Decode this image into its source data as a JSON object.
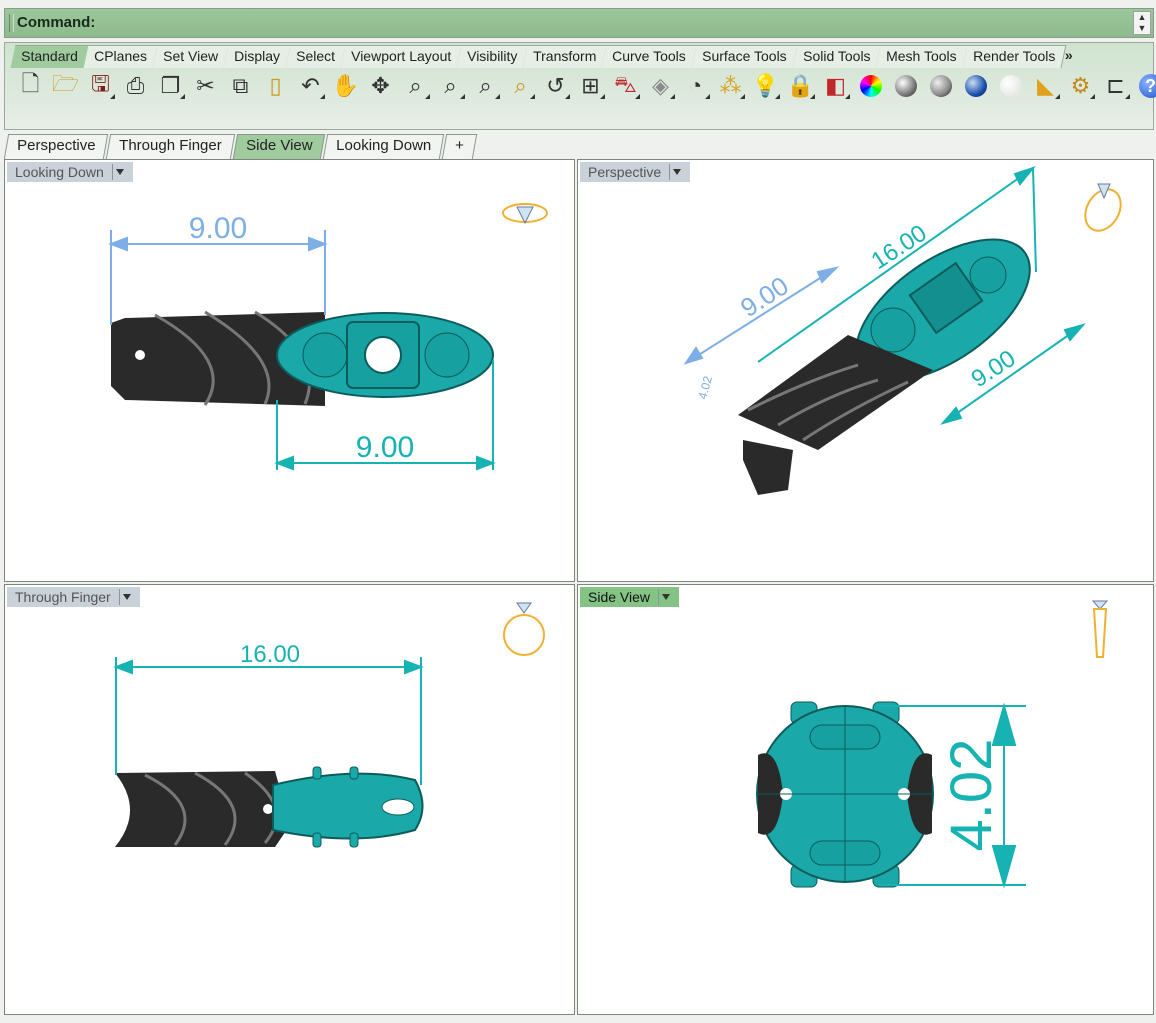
{
  "command": {
    "label": "Command:"
  },
  "toolbar_tabs": [
    "Standard",
    "CPlanes",
    "Set View",
    "Display",
    "Select",
    "Viewport Layout",
    "Visibility",
    "Transform",
    "Curve Tools",
    "Surface Tools",
    "Solid Tools",
    "Mesh Tools",
    "Render Tools"
  ],
  "toolbar_tabs_more": "»",
  "toolbar_icons": [
    "new-file",
    "open-file",
    "save",
    "print",
    "properties",
    "cut",
    "copy",
    "paste",
    "undo",
    "pan",
    "rotate-view",
    "zoom-window",
    "zoom-extents",
    "zoom-selected",
    "zoom-target",
    "undo-view",
    "four-viewports",
    "car-render",
    "grid",
    "circle",
    "select-points",
    "light-bulb",
    "lock",
    "layers",
    "color-wheel",
    "shaded-sphere",
    "rendered-sphere",
    "blue-sphere",
    "ghost-sphere",
    "material-pick",
    "settings-gear",
    "dimension",
    "help"
  ],
  "viewport_tabs": [
    "Perspective",
    "Through Finger",
    "Side View",
    "Looking Down"
  ],
  "viewport_tab_add": "+",
  "active_viewport": "Side View",
  "viewports": {
    "top_left": {
      "title": "Looking Down",
      "dims": [
        "9.00",
        "9.00"
      ]
    },
    "top_right": {
      "title": "Perspective",
      "dims": [
        "16.00",
        "9.00",
        "9.00",
        "4.02"
      ]
    },
    "bottom_left": {
      "title": "Through Finger",
      "dims": [
        "16.00"
      ]
    },
    "bottom_right": {
      "title": "Side View",
      "dims": [
        "4.02"
      ]
    }
  },
  "colors": {
    "model_teal": "#1aa8a8",
    "dim_blue": "#7eaee6",
    "dim_teal": "#17b3b3",
    "ring_gold": "#f0b030",
    "active_green": "#84c384"
  }
}
